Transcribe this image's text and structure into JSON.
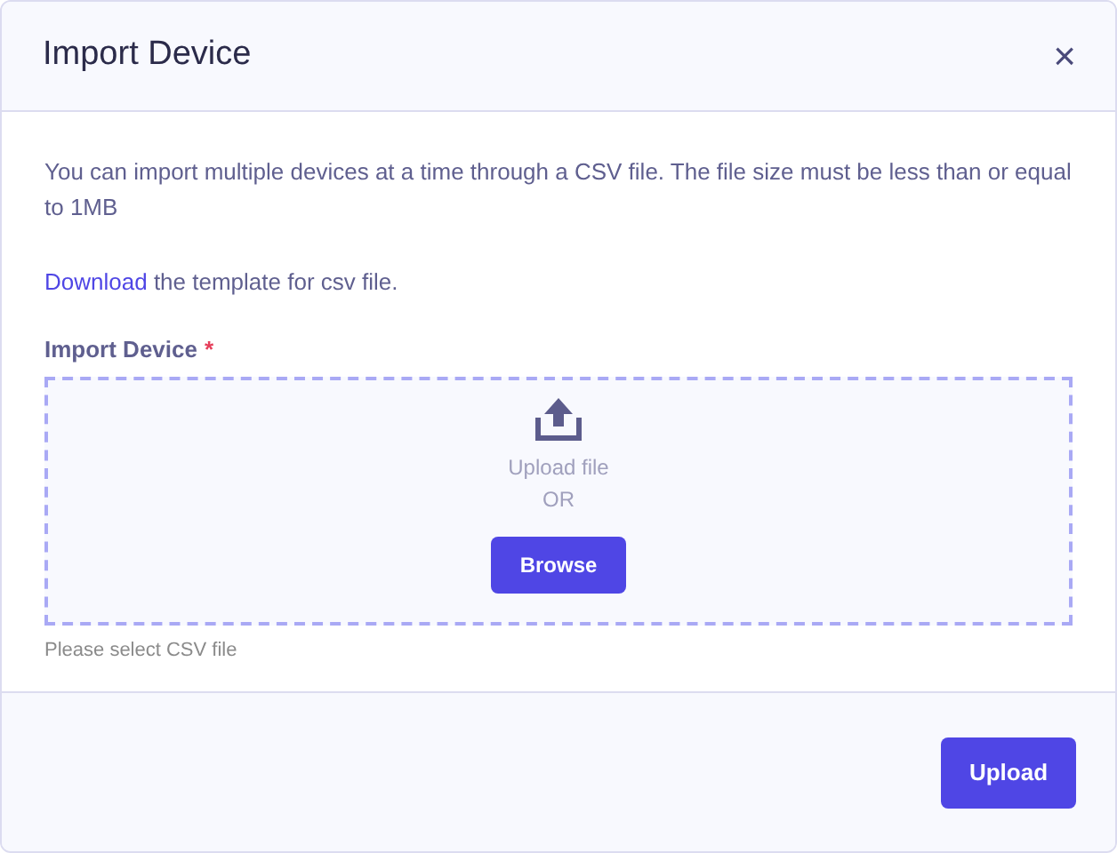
{
  "dialog": {
    "title": "Import Device",
    "close": "×"
  },
  "description": "You can import multiple devices at a time through a CSV file. The file size must be less than or equal to 1MB",
  "template_line": {
    "link": "Download",
    "text": " the template for csv file."
  },
  "field": {
    "label": "Import Device",
    "required_mark": "*",
    "dropzone": {
      "text": "Upload file",
      "or": "OR",
      "button": "Browse"
    },
    "help": "Please select CSV file"
  },
  "footer": {
    "button": "Upload"
  }
}
